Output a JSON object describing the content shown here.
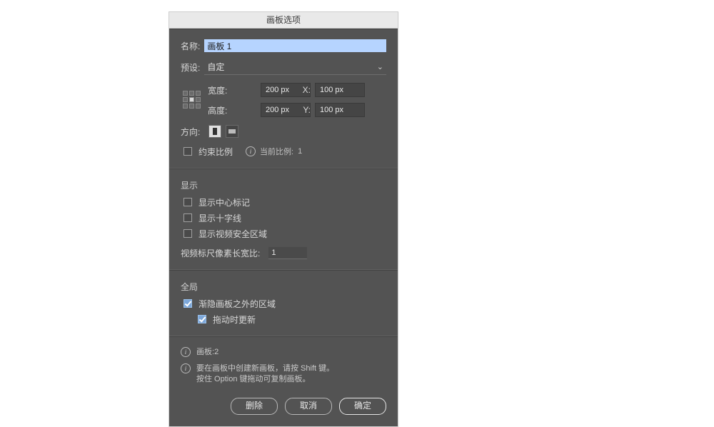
{
  "window": {
    "title": "画板选项"
  },
  "name": {
    "label": "名称:",
    "value": "画板 1"
  },
  "preset": {
    "label": "预设:",
    "value": "自定"
  },
  "dims": {
    "width_label": "宽度:",
    "width_value": "200 px",
    "height_label": "高度:",
    "height_value": "200 px",
    "x_label": "X:",
    "x_value": "100 px",
    "y_label": "Y:",
    "y_value": "100 px"
  },
  "orient": {
    "label": "方向:"
  },
  "constrain": {
    "label": "约束比例",
    "checked": false,
    "ratio_label": "当前比例:",
    "ratio_value": "1"
  },
  "display": {
    "title": "显示",
    "center_mark": {
      "label": "显示中心标记",
      "checked": false
    },
    "crosshair": {
      "label": "显示十字线",
      "checked": false
    },
    "video_safe": {
      "label": "显示视频安全区域",
      "checked": false
    },
    "video_ratio_label": "视频标尺像素长宽比:",
    "video_ratio_value": "1"
  },
  "global": {
    "title": "全局",
    "fade": {
      "label": "渐隐画板之外的区域",
      "checked": true
    },
    "drag_update": {
      "label": "拖动时更新",
      "checked": true
    }
  },
  "info": {
    "count_label": "画板:",
    "count_value": "2",
    "tip_line1": "要在画板中创建新画板，请按 Shift 键。",
    "tip_line2": "按住 Option 键拖动可复制画板。"
  },
  "buttons": {
    "delete": "删除",
    "cancel": "取消",
    "ok": "确定"
  }
}
